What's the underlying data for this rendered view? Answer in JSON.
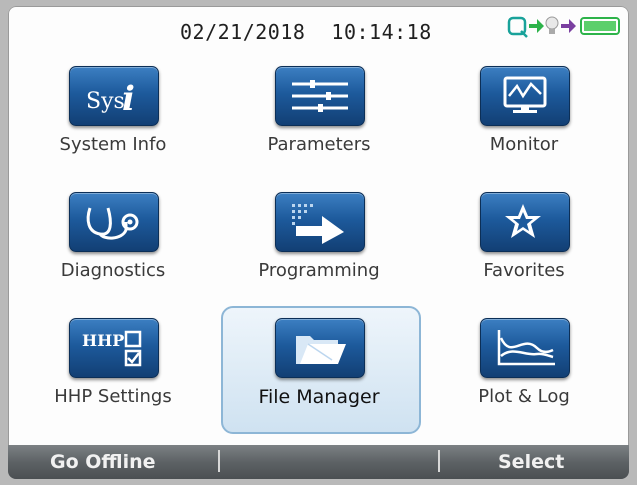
{
  "header": {
    "date": "02/21/2018",
    "time": "10:14:18"
  },
  "status_icons": [
    "connection-icon",
    "arrow-icon",
    "lightbulb-icon",
    "arrow-icon",
    "battery-icon"
  ],
  "tiles": [
    {
      "label": "System Info",
      "icon": "system-info-icon"
    },
    {
      "label": "Parameters",
      "icon": "parameters-icon"
    },
    {
      "label": "Monitor",
      "icon": "monitor-icon"
    },
    {
      "label": "Diagnostics",
      "icon": "stethoscope-icon"
    },
    {
      "label": "Programming",
      "icon": "programming-icon"
    },
    {
      "label": "Favorites",
      "icon": "favorites-star-icon"
    },
    {
      "label": "HHP Settings",
      "icon": "hhp-settings-icon",
      "icon_text": "HHP"
    },
    {
      "label": "File Manager",
      "icon": "folder-icon",
      "selected": true
    },
    {
      "label": "Plot & Log",
      "icon": "plot-log-icon"
    }
  ],
  "system_info_icon_text": "Sys",
  "softkeys": {
    "left": "Go Offline",
    "middle": "",
    "right": "Select"
  },
  "colors": {
    "button_blue": "#1d5a9c",
    "selection_border": "#8db6d6",
    "bar_gray": "#5d6265"
  }
}
